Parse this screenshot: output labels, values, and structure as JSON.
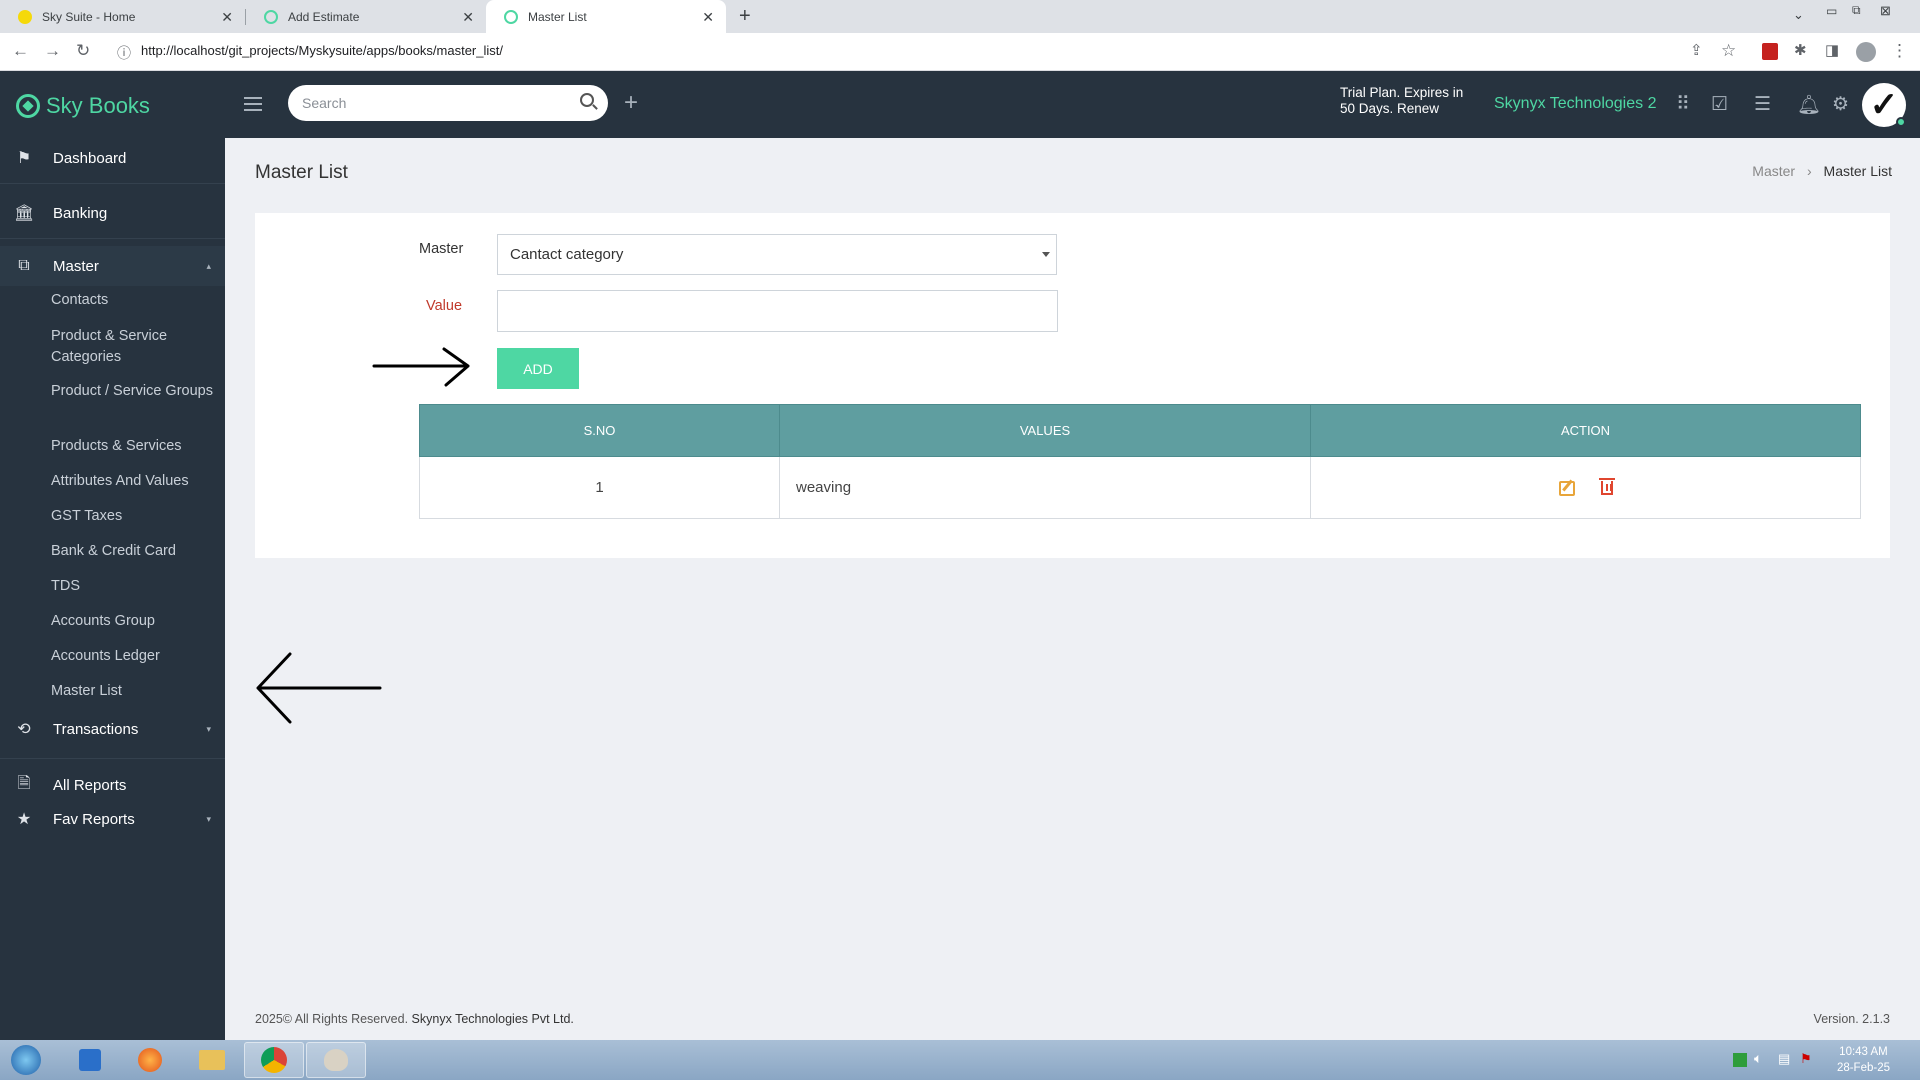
{
  "browser": {
    "tabs": [
      {
        "title": "Sky Suite - Home"
      },
      {
        "title": "Add Estimate"
      },
      {
        "title": "Master List"
      }
    ],
    "url": "http://localhost/git_projects/Myskysuite/apps/books/master_list/"
  },
  "header": {
    "brand": "Sky Books",
    "search_placeholder": "Search",
    "trial_text": "Trial Plan. Expires in 50 Days. Renew",
    "company": "Skynyx Technologies 2"
  },
  "sidebar": {
    "sections": [
      {
        "label": "Dashboard"
      },
      {
        "label": "Banking"
      },
      {
        "label": "Master"
      },
      {
        "label": "Transactions"
      },
      {
        "label": "All Reports"
      },
      {
        "label": "Fav Reports"
      }
    ],
    "master_items": [
      {
        "label": "Contacts"
      },
      {
        "label": "Product & Service Categories"
      },
      {
        "label": "Product / Service Groups"
      },
      {
        "label": "Products & Services"
      },
      {
        "label": "Attributes And Values"
      },
      {
        "label": "GST Taxes"
      },
      {
        "label": "Bank & Credit Card"
      },
      {
        "label": "TDS"
      },
      {
        "label": "Accounts Group"
      },
      {
        "label": "Accounts Ledger"
      },
      {
        "label": "Master List"
      }
    ]
  },
  "page": {
    "title": "Master List",
    "breadcrumb": [
      "Master",
      "Master List"
    ],
    "form": {
      "master_label": "Master",
      "master_value": "Cantact category",
      "value_label": "Value",
      "value_input": "",
      "add_label": "ADD"
    },
    "table": {
      "headers": [
        "S.NO",
        "VALUES",
        "ACTION"
      ],
      "rows": [
        {
          "sno": "1",
          "value": "weaving"
        }
      ]
    }
  },
  "footer": {
    "copyright": "2025© All Rights Reserved.",
    "company": "Skynyx Technologies Pvt Ltd.",
    "version": "Version. 2.1.3"
  },
  "taskbar": {
    "time": "10:43 AM",
    "date": "28-Feb-25"
  },
  "colors": {
    "sidebar_bg": "#27333f",
    "accent_green": "#4ed7a3",
    "table_header": "#5f9ea0",
    "value_label_red": "#c0392b",
    "edit_icon": "#e8a53a",
    "delete_icon": "#e0462f"
  }
}
